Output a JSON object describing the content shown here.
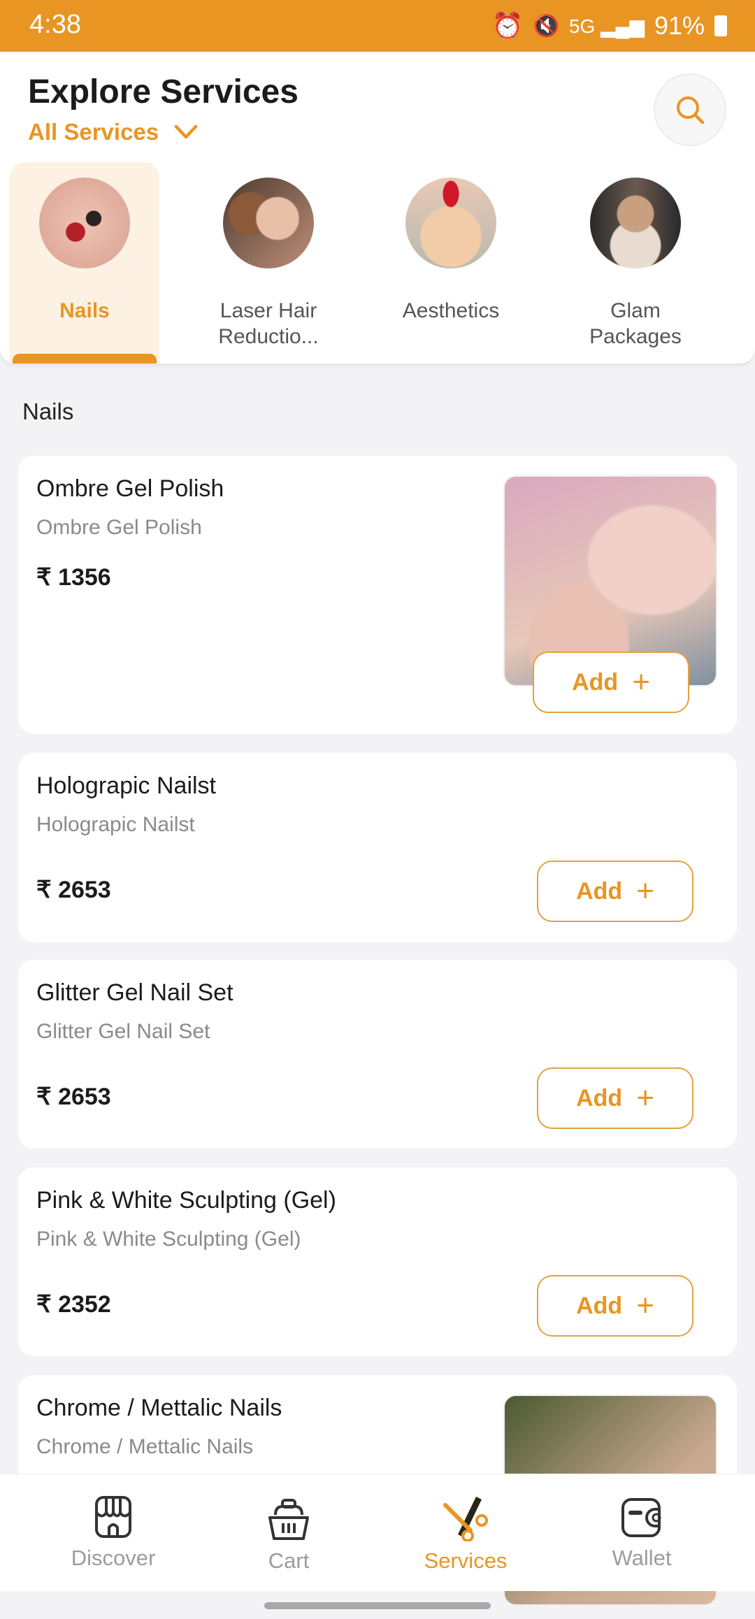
{
  "status_bar": {
    "time": "4:38",
    "battery": "91%",
    "icons": [
      "alarm-icon",
      "mute-icon",
      "volte-icon",
      "5g-icon",
      "signal-icon",
      "battery-icon"
    ]
  },
  "header": {
    "title": "Explore Services",
    "filter_label": "All Services",
    "search_icon": "search-icon"
  },
  "categories": [
    {
      "label": "Nails",
      "active": true
    },
    {
      "label": "Laser Hair Reductio...",
      "active": false
    },
    {
      "label": "Aesthetics",
      "active": false
    },
    {
      "label": "Glam Packages",
      "active": false
    }
  ],
  "section_title": "Nails",
  "services": [
    {
      "name": "Ombre Gel Polish",
      "subtitle": "Ombre Gel Polish",
      "price": "₹ 1356",
      "has_image": true,
      "add_label": "Add"
    },
    {
      "name": "Holograpic Nailst",
      "subtitle": "Holograpic Nailst",
      "price": "₹ 2653",
      "has_image": false,
      "add_label": "Add"
    },
    {
      "name": "Glitter Gel Nail Set",
      "subtitle": "Glitter Gel Nail Set",
      "price": "₹ 2653",
      "has_image": false,
      "add_label": "Add"
    },
    {
      "name": "Pink & White Sculpting (Gel)",
      "subtitle": "Pink & White Sculpting (Gel)",
      "price": "₹ 2352",
      "has_image": false,
      "add_label": "Add"
    },
    {
      "name": "Chrome / Mettalic Nails",
      "subtitle": "Chrome / Mettalic Nails",
      "has_image": true
    }
  ],
  "bottom_nav": [
    {
      "label": "Discover",
      "icon": "store-icon"
    },
    {
      "label": "Cart",
      "icon": "basket-icon"
    },
    {
      "label": "Services",
      "icon": "scissors-comb-icon",
      "active": true
    },
    {
      "label": "Wallet",
      "icon": "wallet-icon"
    }
  ],
  "colors": {
    "accent": "#e99524",
    "background": "#f3f3f6",
    "active_tab_bg": "#fcf1e2"
  }
}
